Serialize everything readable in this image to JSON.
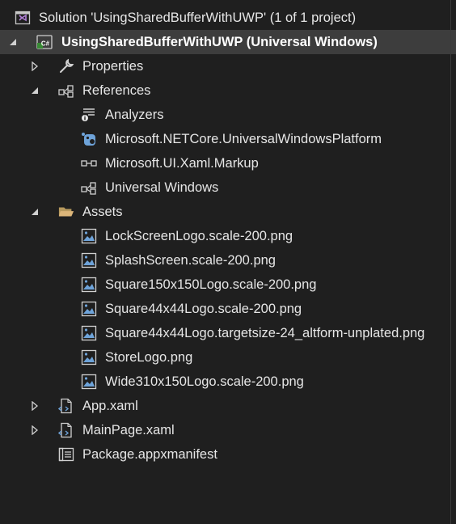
{
  "solution": {
    "label": "Solution 'UsingSharedBufferWithUWP' (1 of 1 project)",
    "icon": "solution-icon"
  },
  "project": {
    "label": "UsingSharedBufferWithUWP (Universal Windows)",
    "icon": "csharp-project-icon",
    "badge": "C#"
  },
  "nodes": {
    "properties": {
      "label": "Properties",
      "icon": "wrench-icon"
    },
    "references": {
      "label": "References",
      "icon": "references-icon"
    },
    "analyzers": {
      "label": "Analyzers",
      "icon": "analyzers-icon"
    },
    "netcore": {
      "label": "Microsoft.NETCore.UniversalWindowsPlatform",
      "icon": "nuget-package-icon"
    },
    "xamlmarkup": {
      "label": "Microsoft.UI.Xaml.Markup",
      "icon": "assembly-reference-icon"
    },
    "universal": {
      "label": "Universal Windows",
      "icon": "references-icon"
    },
    "assets": {
      "label": "Assets",
      "icon": "open-folder-icon"
    },
    "appxaml": {
      "label": "App.xaml",
      "icon": "xaml-file-icon"
    },
    "mainpage": {
      "label": "MainPage.xaml",
      "icon": "xaml-file-icon"
    },
    "manifest": {
      "label": "Package.appxmanifest",
      "icon": "manifest-icon"
    }
  },
  "assets_files": [
    "LockScreenLogo.scale-200.png",
    "SplashScreen.scale-200.png",
    "Square150x150Logo.scale-200.png",
    "Square44x44Logo.scale-200.png",
    "Square44x44Logo.targetsize-24_altform-unplated.png",
    "StoreLogo.png",
    "Wide310x150Logo.scale-200.png"
  ],
  "colors": {
    "background": "#1f1f1f",
    "selected_row": "#3d3d3d",
    "text": "#e6e6e6",
    "solution_icon": "#b180d7",
    "csharp_icon": "#388a34",
    "image_icon": "#6ea3d9",
    "folder_icon": "#dcb67a"
  }
}
